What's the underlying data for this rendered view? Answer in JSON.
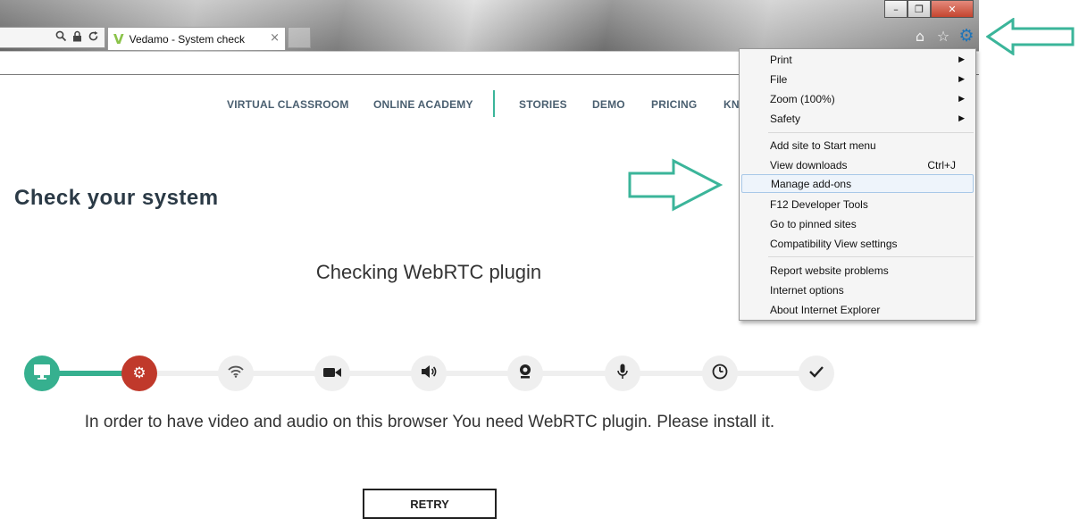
{
  "browser": {
    "tab_title": "Vedamo - System check",
    "tab_close": "×",
    "favicon": "V",
    "address_icons": [
      "search-icon",
      "lock-icon",
      "refresh-icon"
    ],
    "window_controls": {
      "minimize": "–",
      "restore": "❐",
      "close": "✕"
    }
  },
  "toolbar": {
    "home": "⌂",
    "favorites": "☆",
    "tools": "⚙"
  },
  "nav": {
    "items": [
      "VIRTUAL CLASSROOM",
      "ONLINE ACADEMY",
      "STORIES",
      "DEMO",
      "PRICING",
      "KN"
    ]
  },
  "page": {
    "title": "Check your system",
    "subtitle": "Checking WebRTC plugin",
    "message": "In order to have video and audio on this browser You need WebRTC plugin. Please install it.",
    "retry_label": "RETRY"
  },
  "steps": [
    {
      "icon": "monitor-icon",
      "status": "done"
    },
    {
      "icon": "gear-icon",
      "status": "error"
    },
    {
      "icon": "wifi-icon",
      "status": "pending"
    },
    {
      "icon": "camera-icon",
      "status": "pending"
    },
    {
      "icon": "speaker-icon",
      "status": "pending"
    },
    {
      "icon": "webcam-icon",
      "status": "pending"
    },
    {
      "icon": "microphone-icon",
      "status": "pending"
    },
    {
      "icon": "clock-icon",
      "status": "pending"
    },
    {
      "icon": "checkmark-icon",
      "status": "pending"
    }
  ],
  "menu": {
    "print": "Print",
    "file": "File",
    "zoom": "Zoom (100%)",
    "safety": "Safety",
    "add_site": "Add site to Start menu",
    "view_downloads": "View downloads",
    "view_downloads_shortcut": "Ctrl+J",
    "manage_addons": "Manage add-ons",
    "dev_tools": "F12 Developer Tools",
    "pinned_sites": "Go to pinned sites",
    "compat_view": "Compatibility View settings",
    "report_problems": "Report website problems",
    "internet_options": "Internet options",
    "about_ie": "About Internet Explorer",
    "submenu_arrow": "▶"
  },
  "colors": {
    "accent": "#36b08f",
    "error": "#c0392b",
    "annotation": "#3bb59a",
    "nav_text": "#4a5f70"
  }
}
